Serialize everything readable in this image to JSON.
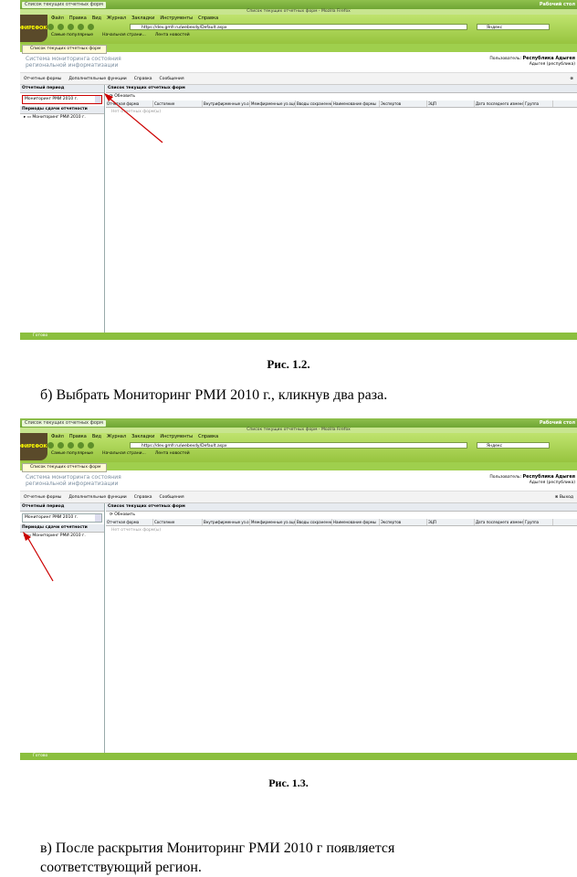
{
  "browser": {
    "taskbar_label": "Рабочий стол",
    "window_title": "Список текущих отчетных форм - Mozilla Firefox",
    "menu": [
      "Файл",
      "Правка",
      "Вид",
      "Журнал",
      "Закладки",
      "Инструменты",
      "Справка"
    ],
    "address": "https://dev.gmfr.ru/webexdy/Default.aspx",
    "search_placeholder": "Яндекс",
    "bookmarks": [
      "Самые популярные",
      "Начальная страни...",
      "Лента новостей"
    ],
    "tab_label": "Список текущих отчетных форм",
    "status_text": "Готово",
    "logo_text": "ФИРЕФОКС"
  },
  "app": {
    "title_line1": "Система мониторинга состояния",
    "title_line2": "региональной информатизации",
    "user_label": "Пользователь:",
    "user_name": "Республика Адыгея",
    "user_sub": "Адыгея (республика)",
    "toolbar": [
      "Отчетные формы",
      "Дополнительные функции",
      "Справка",
      "Сообщения"
    ],
    "exit_label": "Выход",
    "period_header": "Отчетный период",
    "period_value": "Мониторинг РМИ 2010 г.",
    "tree_header": "Периоды сдачи отчетности",
    "tree_item": "Мониторинг РМИ 2010 г.",
    "right_header": "Список текущих отчетных форм",
    "refresh_label": "Обновить",
    "columns": [
      "Отчетная форма",
      "Состояние",
      "Внутрифирменные уз.оценки",
      "Межфирменные уз.оценки",
      "Вводы сохраненные",
      "Наименование формы",
      "Экспертов",
      "ЭЦП",
      "Дата последнего изменения",
      "Группа"
    ],
    "empty_text": "Нет отчетных форм(ы)"
  },
  "document": {
    "caption1": "Рис. 1.2.",
    "para1": "б) Выбрать Мониторинг РМИ 2010 г., кликнув два раза.",
    "caption2": "Рис. 1.3.",
    "para2_line1": "в) После раскрытия Мониторинг РМИ 2010 г появляется",
    "para2_line2": "соответствующий регион."
  }
}
